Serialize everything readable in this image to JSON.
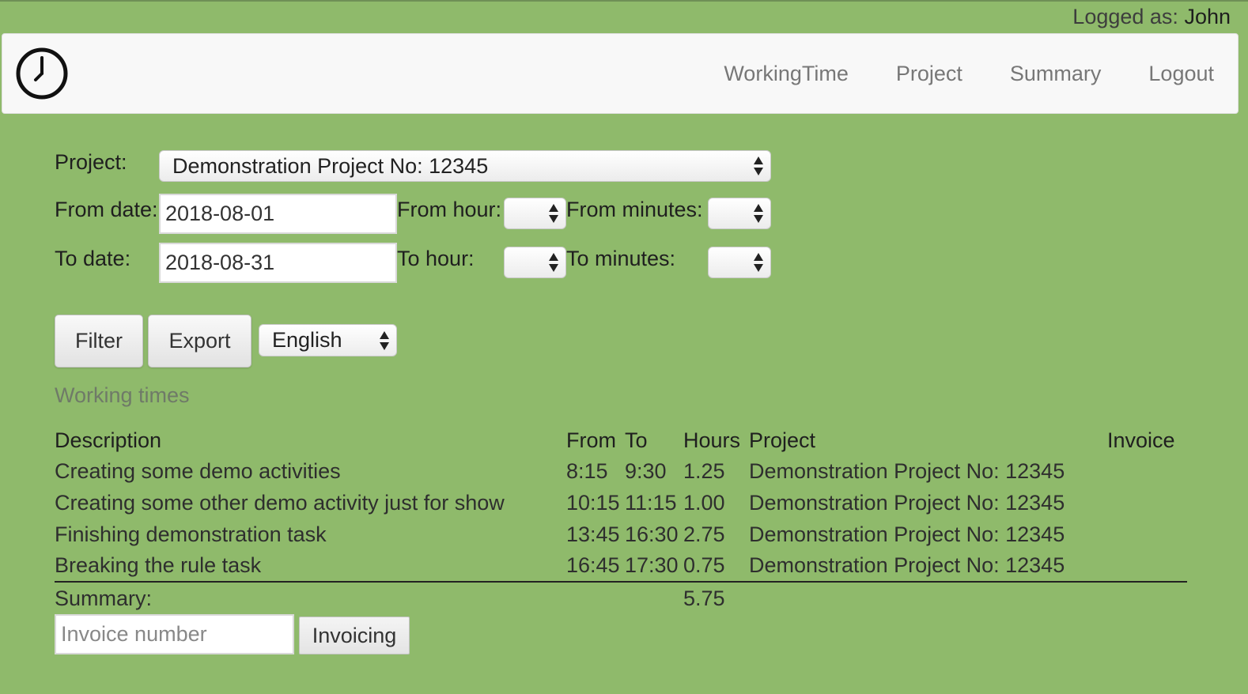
{
  "header": {
    "logged_prefix": "Logged as:",
    "user": "John"
  },
  "nav": {
    "logo_icon": "clock-icon",
    "links": [
      "WorkingTime",
      "Project",
      "Summary",
      "Logout"
    ]
  },
  "filter": {
    "project_label": "Project:",
    "project_value": "Demonstration Project No: 12345",
    "from_date_label": "From date:",
    "from_date_value": "2018-08-01",
    "from_hour_label": "From hour:",
    "from_minutes_label": "From minutes:",
    "to_date_label": "To date:",
    "to_date_value": "2018-08-31",
    "to_hour_label": "To hour:",
    "to_minutes_label": "To minutes:",
    "filter_button": "Filter",
    "export_button": "Export",
    "language_value": "English"
  },
  "working_times": {
    "title": "Working times",
    "columns": [
      "Description",
      "From",
      "To",
      "Hours",
      "Project",
      "Invoice"
    ],
    "rows": [
      {
        "description": "Creating some demo activities",
        "from": "8:15",
        "to": "9:30",
        "hours": "1.25",
        "project": "Demonstration Project No: 12345",
        "invoice": ""
      },
      {
        "description": "Creating some other demo activity just for show",
        "from": "10:15",
        "to": "11:15",
        "hours": "1.00",
        "project": "Demonstration Project No: 12345",
        "invoice": ""
      },
      {
        "description": "Finishing demonstration task",
        "from": "13:45",
        "to": "16:30",
        "hours": "2.75",
        "project": "Demonstration Project No: 12345",
        "invoice": ""
      },
      {
        "description": "Breaking the rule task",
        "from": "16:45",
        "to": "17:30",
        "hours": "0.75",
        "project": "Demonstration Project No: 12345",
        "invoice": ""
      }
    ],
    "summary_label": "Summary:",
    "summary_hours": "5.75"
  },
  "invoicing": {
    "invoice_placeholder": "Invoice number",
    "invoicing_button": "Invoicing"
  },
  "colors": {
    "background": "#8fba6b",
    "navbar": "#f8f8f8"
  }
}
